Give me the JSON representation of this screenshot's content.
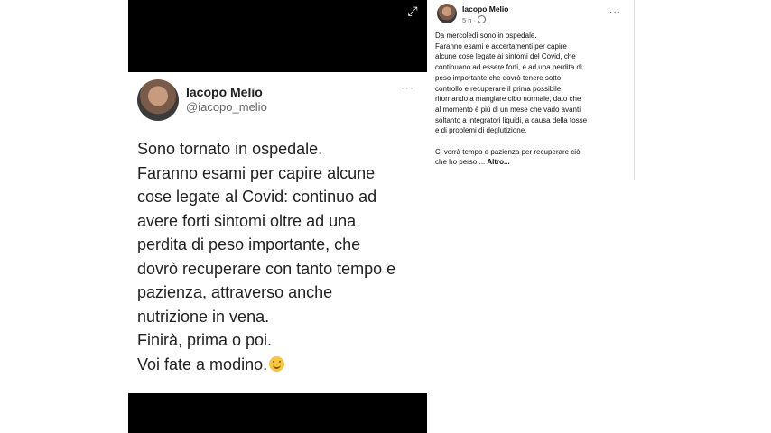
{
  "tweet": {
    "name": "Iacopo Melio",
    "handle": "@iacopo_melio",
    "more": "···",
    "lines": [
      "Sono tornato in ospedale.",
      "Faranno esami per capire alcune",
      "cose legate al Covid: continuo ad",
      "avere forti sintomi oltre ad una",
      "perdita di peso importante, che",
      "dovrò recuperare con tanto tempo e",
      "pazienza, attraverso anche",
      "nutrizione in vena.",
      "Finirà, prima o poi.",
      "Voi fate a modino."
    ],
    "emoji": "smiling-face-emoji"
  },
  "viewer": {
    "expand_icon": "⤢"
  },
  "facebook": {
    "name": "Iacopo Melio",
    "time": "5 h ·",
    "more": "···",
    "paragraph1": [
      "Da mercoledì sono in ospedale.",
      "Faranno esami e accertamenti per capire",
      "alcune cose legate ai sintomi del Covid, che",
      "continuano ad essere forti, e ad una perdita di",
      "peso importante che dovrò tenere sotto",
      "controllo e recuperare il prima possibile,",
      "ritornando a mangiare cibo normale, dato che",
      "al momento è più di un mese che vado avanti",
      "soltanto a integratori liquidi, a causa della tosse",
      "e di problemi di deglutizione."
    ],
    "paragraph2_line1": "Ci vorrà tempo e pazienza per recuperare ciò",
    "paragraph2_line2": "che ho perso....",
    "see_more": "Altro..."
  }
}
